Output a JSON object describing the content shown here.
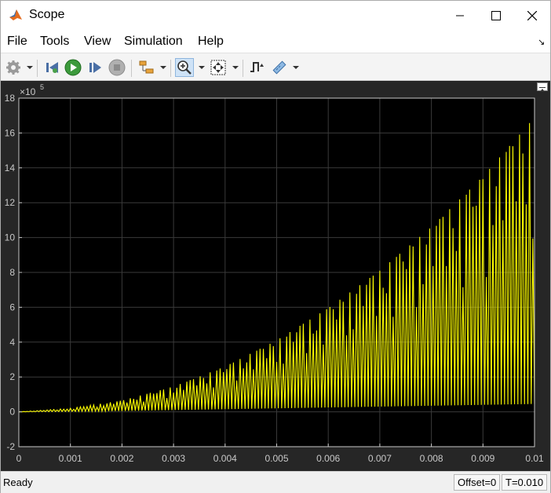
{
  "window": {
    "title": "Scope"
  },
  "menu": {
    "items": [
      "File",
      "Tools",
      "View",
      "Simulation",
      "Help"
    ]
  },
  "toolbar": {
    "buttons": [
      "settings-icon",
      "step-back-icon",
      "run-icon",
      "step-forward-icon",
      "stop-icon",
      "signal-selector-icon",
      "zoom-in-icon",
      "autoscale-icon",
      "triggers-icon",
      "cursor-measurements-icon"
    ]
  },
  "plot": {
    "background": "#000000",
    "trace_color": "#ffff00",
    "axes_color": "#c8c8c8",
    "exponent_label": "×10",
    "exponent_power": "5"
  },
  "chart_data": {
    "type": "line",
    "title": "",
    "xlabel": "",
    "ylabel": "",
    "xlim": [
      0,
      0.01
    ],
    "ylim": [
      -2,
      18
    ],
    "y_multiplier": 100000,
    "grid": true,
    "xticks": [
      "0",
      "0.001",
      "0.002",
      "0.003",
      "0.004",
      "0.005",
      "0.006",
      "0.007",
      "0.008",
      "0.009",
      "0.01"
    ],
    "yticks": [
      "-2",
      "0",
      "2",
      "4",
      "6",
      "8",
      "10",
      "12",
      "14",
      "16",
      "18"
    ],
    "series": [
      {
        "color": "#ffff00",
        "envelope_upper": {
          "x": [
            0,
            0.001,
            0.002,
            0.003,
            0.004,
            0.005,
            0.006,
            0.007,
            0.008,
            0.009,
            0.01
          ],
          "y": [
            0,
            0.2,
            0.65,
            1.45,
            2.6,
            4.1,
            5.95,
            8.1,
            10.6,
            13.5,
            16.9
          ]
        },
        "envelope_lower": {
          "x": [
            0,
            0.002,
            0.004,
            0.006,
            0.008,
            0.01
          ],
          "y": [
            0,
            0.05,
            0.15,
            0.25,
            0.35,
            0.45
          ]
        },
        "oscillation_cycles": 155
      }
    ]
  },
  "status": {
    "text": "Ready",
    "offset": "Offset=0",
    "time": "T=0.010"
  }
}
